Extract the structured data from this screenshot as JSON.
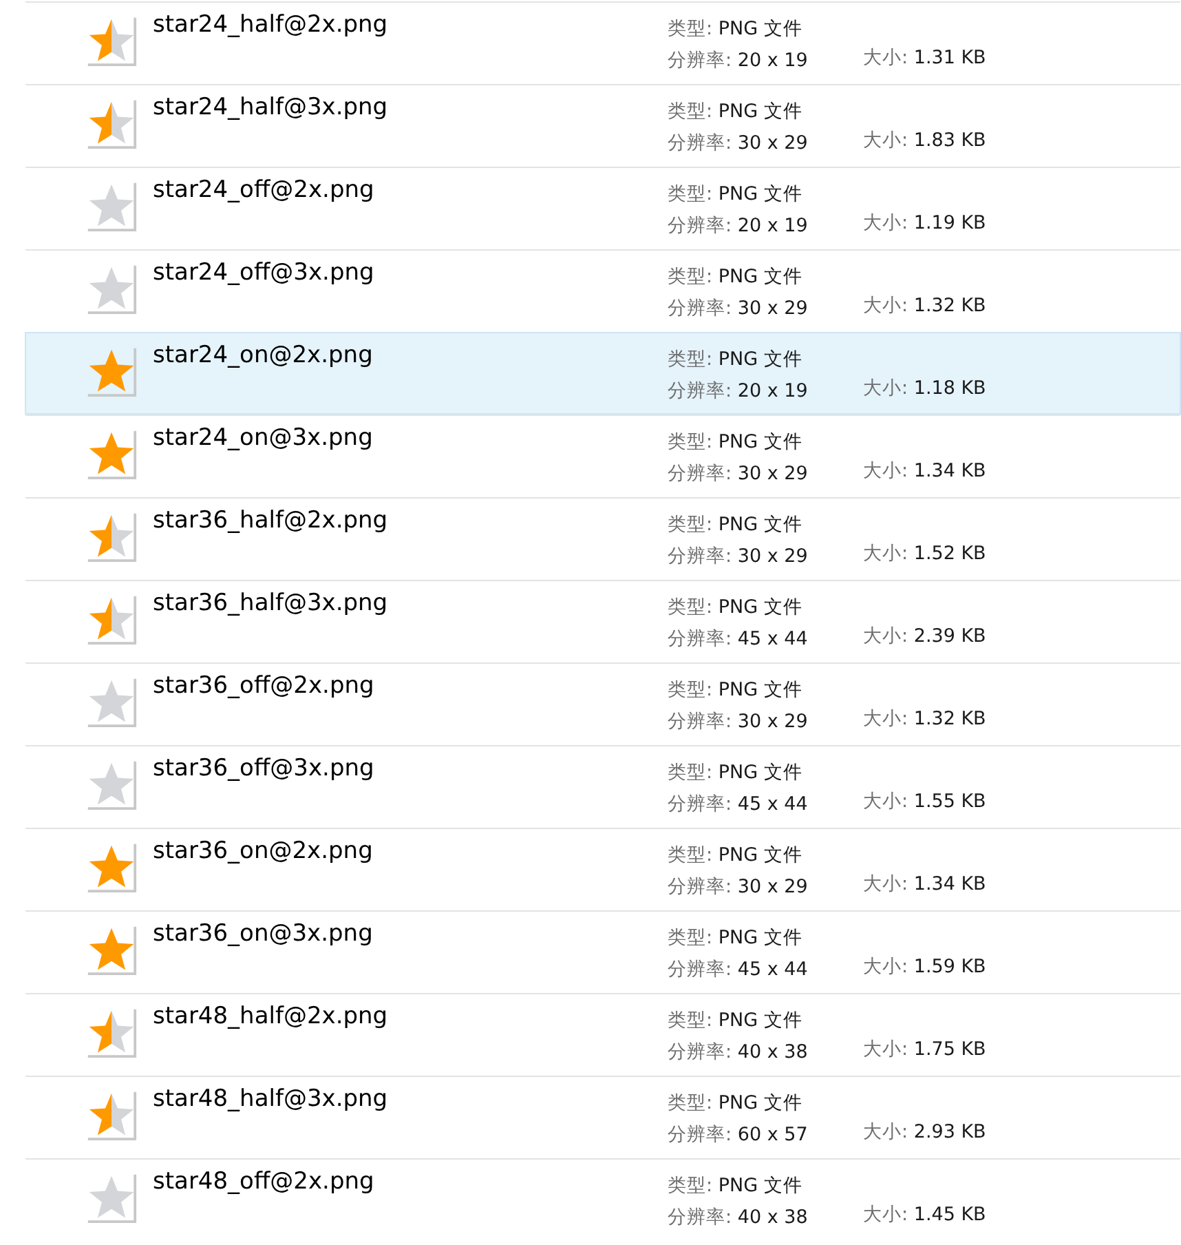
{
  "files": [
    {
      "name": "star24_half@2x.png",
      "kind": "half",
      "type_label": "类型:",
      "type_value": "PNG 文件",
      "resolution_label": "分辨率:",
      "resolution_value": "20 x 19",
      "size_label": "大小:",
      "size_value": "1.31 KB",
      "selected": false
    },
    {
      "name": "star24_half@3x.png",
      "kind": "half",
      "type_label": "类型:",
      "type_value": "PNG 文件",
      "resolution_label": "分辨率:",
      "resolution_value": "30 x 29",
      "size_label": "大小:",
      "size_value": "1.83 KB",
      "selected": false
    },
    {
      "name": "star24_off@2x.png",
      "kind": "off",
      "type_label": "类型:",
      "type_value": "PNG 文件",
      "resolution_label": "分辨率:",
      "resolution_value": "20 x 19",
      "size_label": "大小:",
      "size_value": "1.19 KB",
      "selected": false
    },
    {
      "name": "star24_off@3x.png",
      "kind": "off",
      "type_label": "类型:",
      "type_value": "PNG 文件",
      "resolution_label": "分辨率:",
      "resolution_value": "30 x 29",
      "size_label": "大小:",
      "size_value": "1.32 KB",
      "selected": false
    },
    {
      "name": "star24_on@2x.png",
      "kind": "on",
      "type_label": "类型:",
      "type_value": "PNG 文件",
      "resolution_label": "分辨率:",
      "resolution_value": "20 x 19",
      "size_label": "大小:",
      "size_value": "1.18 KB",
      "selected": true
    },
    {
      "name": "star24_on@3x.png",
      "kind": "on",
      "type_label": "类型:",
      "type_value": "PNG 文件",
      "resolution_label": "分辨率:",
      "resolution_value": "30 x 29",
      "size_label": "大小:",
      "size_value": "1.34 KB",
      "selected": false
    },
    {
      "name": "star36_half@2x.png",
      "kind": "half",
      "type_label": "类型:",
      "type_value": "PNG 文件",
      "resolution_label": "分辨率:",
      "resolution_value": "30 x 29",
      "size_label": "大小:",
      "size_value": "1.52 KB",
      "selected": false
    },
    {
      "name": "star36_half@3x.png",
      "kind": "half",
      "type_label": "类型:",
      "type_value": "PNG 文件",
      "resolution_label": "分辨率:",
      "resolution_value": "45 x 44",
      "size_label": "大小:",
      "size_value": "2.39 KB",
      "selected": false
    },
    {
      "name": "star36_off@2x.png",
      "kind": "off",
      "type_label": "类型:",
      "type_value": "PNG 文件",
      "resolution_label": "分辨率:",
      "resolution_value": "30 x 29",
      "size_label": "大小:",
      "size_value": "1.32 KB",
      "selected": false
    },
    {
      "name": "star36_off@3x.png",
      "kind": "off",
      "type_label": "类型:",
      "type_value": "PNG 文件",
      "resolution_label": "分辨率:",
      "resolution_value": "45 x 44",
      "size_label": "大小:",
      "size_value": "1.55 KB",
      "selected": false
    },
    {
      "name": "star36_on@2x.png",
      "kind": "on",
      "type_label": "类型:",
      "type_value": "PNG 文件",
      "resolution_label": "分辨率:",
      "resolution_value": "30 x 29",
      "size_label": "大小:",
      "size_value": "1.34 KB",
      "selected": false
    },
    {
      "name": "star36_on@3x.png",
      "kind": "on",
      "type_label": "类型:",
      "type_value": "PNG 文件",
      "resolution_label": "分辨率:",
      "resolution_value": "45 x 44",
      "size_label": "大小:",
      "size_value": "1.59 KB",
      "selected": false
    },
    {
      "name": "star48_half@2x.png",
      "kind": "half",
      "type_label": "类型:",
      "type_value": "PNG 文件",
      "resolution_label": "分辨率:",
      "resolution_value": "40 x 38",
      "size_label": "大小:",
      "size_value": "1.75 KB",
      "selected": false
    },
    {
      "name": "star48_half@3x.png",
      "kind": "half",
      "type_label": "类型:",
      "type_value": "PNG 文件",
      "resolution_label": "分辨率:",
      "resolution_value": "60 x 57",
      "size_label": "大小:",
      "size_value": "2.93 KB",
      "selected": false
    },
    {
      "name": "star48_off@2x.png",
      "kind": "off",
      "type_label": "类型:",
      "type_value": "PNG 文件",
      "resolution_label": "分辨率:",
      "resolution_value": "40 x 38",
      "size_label": "大小:",
      "size_value": "1.45 KB",
      "selected": false
    }
  ]
}
